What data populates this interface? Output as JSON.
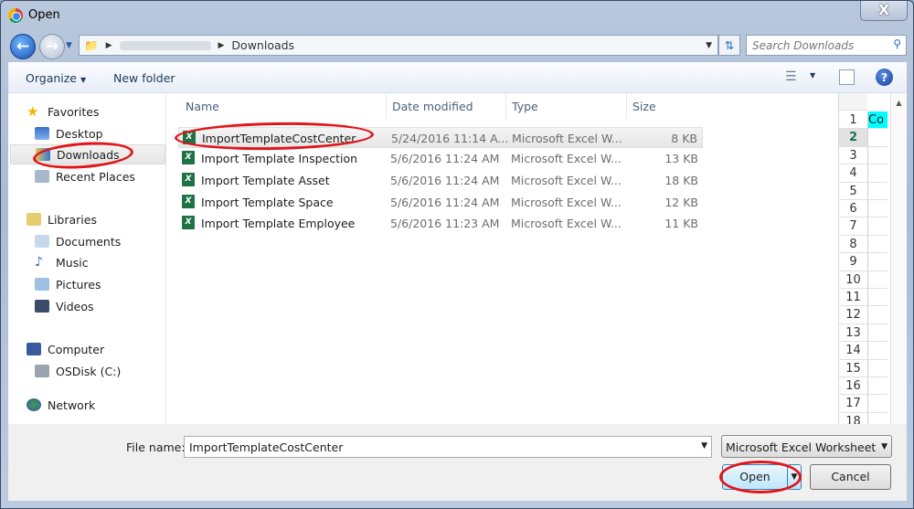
{
  "window": {
    "title": "Open",
    "close": "X"
  },
  "address": {
    "path": [
      "Downloads"
    ],
    "search_placeholder": "Search Downloads"
  },
  "toolbar": {
    "organize": "Organize",
    "new_folder": "New folder",
    "help": "?"
  },
  "nav": {
    "favorites": "Favorites",
    "desktop": "Desktop",
    "downloads": "Downloads",
    "recent": "Recent Places",
    "libraries": "Libraries",
    "documents": "Documents",
    "music": "Music",
    "pictures": "Pictures",
    "videos": "Videos",
    "computer": "Computer",
    "osdisk": "OSDisk (C:)",
    "network": "Network"
  },
  "columns": {
    "name": "Name",
    "date": "Date modified",
    "type": "Type",
    "size": "Size"
  },
  "files": [
    {
      "name": "ImportTemplateCostCenter",
      "date": "5/24/2016 11:14 A...",
      "type": "Microsoft Excel W...",
      "size": "8 KB"
    },
    {
      "name": "Import Template Inspection",
      "date": "5/6/2016 11:24 AM",
      "type": "Microsoft Excel W...",
      "size": "13 KB"
    },
    {
      "name": "Import Template Asset",
      "date": "5/6/2016 11:24 AM",
      "type": "Microsoft Excel W...",
      "size": "18 KB"
    },
    {
      "name": "Import Template Space",
      "date": "5/6/2016 11:24 AM",
      "type": "Microsoft Excel W...",
      "size": "12 KB"
    },
    {
      "name": "Import Template Employee",
      "date": "5/6/2016 11:23 AM",
      "type": "Microsoft Excel W...",
      "size": "11 KB"
    }
  ],
  "preview": {
    "rows": [
      "1",
      "2",
      "3",
      "4",
      "5",
      "6",
      "7",
      "8",
      "9",
      "10",
      "11",
      "12",
      "13",
      "14",
      "15",
      "16",
      "17",
      "18"
    ],
    "cell_a1": "Co",
    "cell_color": "#00ffff"
  },
  "bottom": {
    "file_name_label": "File name:",
    "file_name_value": "ImportTemplateCostCenter",
    "filter": "Microsoft Excel Worksheet",
    "open": "Open",
    "cancel": "Cancel"
  },
  "annotation_color": "#e0161b"
}
